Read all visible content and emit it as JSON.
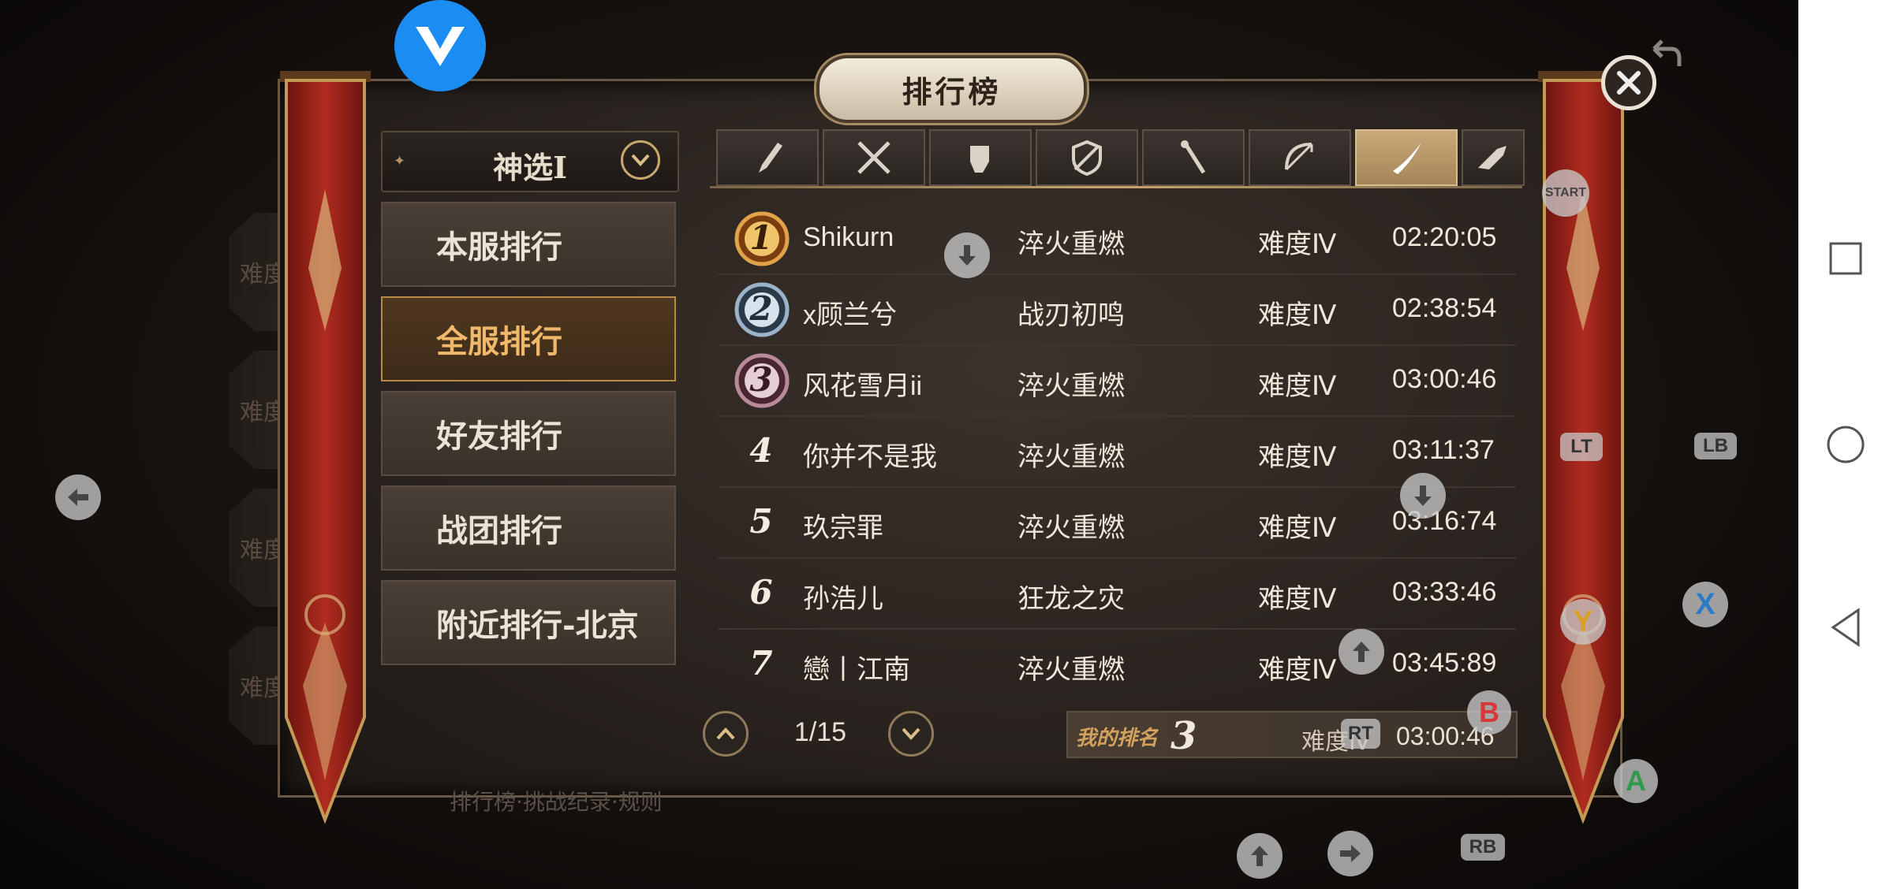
{
  "title": "排行榜",
  "season_selector": {
    "label": "神选I"
  },
  "side_tabs": [
    "难度",
    "难度",
    "难度",
    "难度"
  ],
  "menu": [
    {
      "label": "本服排行",
      "active": false
    },
    {
      "label": "全服排行",
      "active": true
    },
    {
      "label": "好友排行",
      "active": false
    },
    {
      "label": "战团排行",
      "active": false
    },
    {
      "label": "附近排行-北京",
      "active": false
    }
  ],
  "weapon_tabs": [
    {
      "icon": "sword-icon",
      "active": false
    },
    {
      "icon": "crossed-blades-icon",
      "active": false
    },
    {
      "icon": "gauntlet-icon",
      "active": false
    },
    {
      "icon": "shield-icon",
      "active": false
    },
    {
      "icon": "staff-icon",
      "active": false
    },
    {
      "icon": "bow-icon",
      "active": false
    },
    {
      "icon": "curved-blade-icon",
      "active": true
    },
    {
      "icon": "gun-icon",
      "active": false
    }
  ],
  "rows": [
    {
      "rank": "1",
      "medal": "gold",
      "name": "Shikurn",
      "title": "淬火重燃",
      "difficulty": "难度Ⅳ",
      "time": "02:20:05"
    },
    {
      "rank": "2",
      "medal": "silver",
      "name": "x顾兰兮",
      "title": "战刃初鸣",
      "difficulty": "难度Ⅳ",
      "time": "02:38:54"
    },
    {
      "rank": "3",
      "medal": "bronze",
      "name": "风花雪月ii",
      "title": "淬火重燃",
      "difficulty": "难度Ⅳ",
      "time": "03:00:46"
    },
    {
      "rank": "4",
      "medal": "",
      "name": "你并不是我",
      "title": "淬火重燃",
      "difficulty": "难度Ⅳ",
      "time": "03:11:37"
    },
    {
      "rank": "5",
      "medal": "",
      "name": "玖宗罪",
      "title": "淬火重燃",
      "difficulty": "难度Ⅳ",
      "time": "03:16:74"
    },
    {
      "rank": "6",
      "medal": "",
      "name": "孙浩儿",
      "title": "狂龙之灾",
      "difficulty": "难度Ⅳ",
      "time": "03:33:46"
    },
    {
      "rank": "7",
      "medal": "",
      "name": "戀丨江南",
      "title": "淬火重燃",
      "difficulty": "难度Ⅳ",
      "time": "03:45:89"
    }
  ],
  "pager": {
    "text": "1/15"
  },
  "my_rank": {
    "label": "我的排名",
    "rank": "3",
    "difficulty": "难度Ⅳ",
    "time": "03:00:46"
  },
  "bottom_ghost": "排行榜·挑战纪录·规则",
  "gamepad": {
    "start": "START",
    "lt": "LT",
    "lb": "LB",
    "rb": "RB",
    "x": "X",
    "y": "Y",
    "b": "B",
    "a": "A"
  },
  "colors": {
    "accent_active": "#f0b86a",
    "banner_red": "#a3261b",
    "gold_trim": "#c6a46c",
    "app_logo": "#1a8cf2"
  }
}
